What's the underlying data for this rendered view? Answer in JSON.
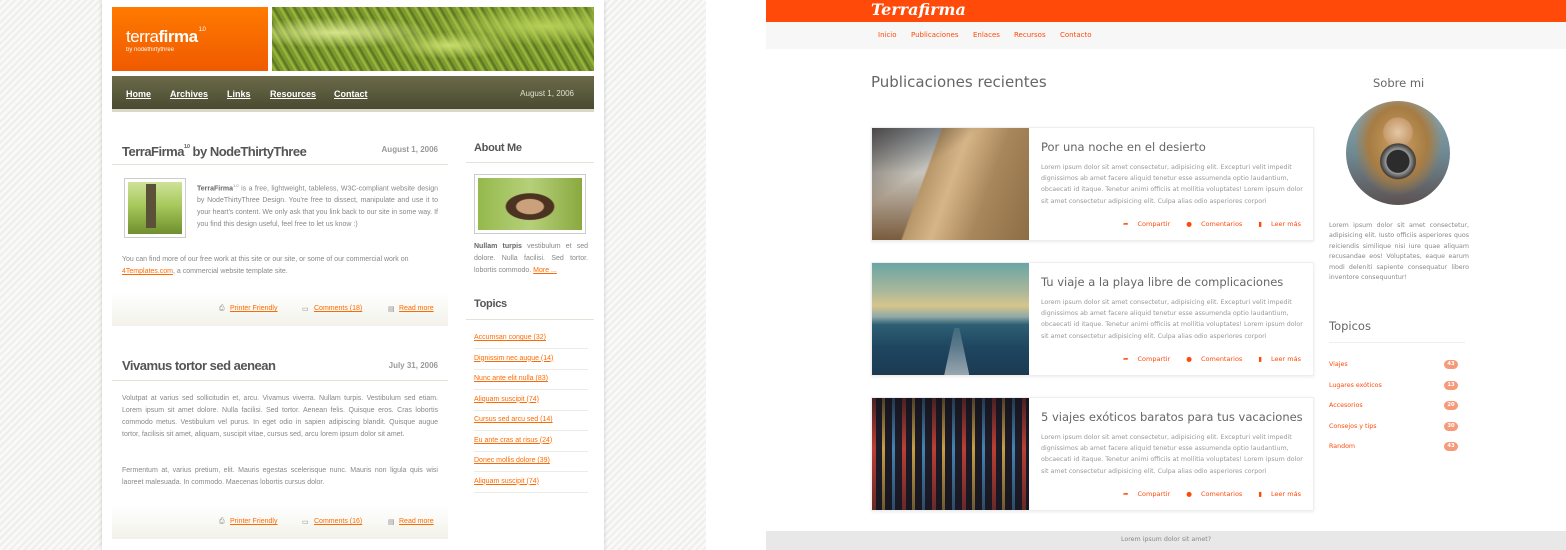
{
  "left": {
    "logo_light": "terra",
    "logo_bold": "firma",
    "logo_version": "1.0",
    "logo_sub": "by nodethirtythree",
    "nav": [
      "Home",
      "Archives",
      "Links",
      "Resources",
      "Contact"
    ],
    "nav_date": "August 1, 2006",
    "post1": {
      "title_main": "TerraFirma",
      "title_sup": "1.0",
      "title_rest": " by NodeThirtyThree",
      "date": "August 1, 2006",
      "p1_bold": "TerraFirma",
      "p1_sup": "1.0",
      "p1_rest": " is a free, lightweight, tableless, W3C-compliant website design by NodeThirtyThree Design. You're free to dissect, manipulate and use it to your heart's content. We only ask that you link back to our site in some way. If you find this design useful, feel free to let us know :)",
      "p2_start": "You can find more of our free work at this site or our site, or some of our commercial work on ",
      "p2_link": "4Templates.com",
      "p2_end": ", a commercial website template site.",
      "printer": "Printer Friendly",
      "comments": "Comments (18)",
      "readmore": "Read more"
    },
    "post2": {
      "title": "Vivamus tortor sed aenean",
      "date": "July 31, 2006",
      "p1": "Volutpat at varius sed sollicitudin et, arcu. Vivamus viverra. Nullam turpis. Vestibulum sed etiam. Lorem ipsum sit amet dolore. Nulla facilisi. Sed tortor. Aenean felis. Quisque eros. Cras lobortis commodo metus. Vestibulum vel purus. In eget odio in sapien adipiscing blandit. Quisque augue tortor, facilisis sit amet, aliquam, suscipit vitae, cursus sed, arcu lorem ipsum dolor sit amet.",
      "p2": "Fermentum at, varius pretium, elit. Mauris egestas scelerisque nunc. Mauris non ligula quis wisi laoreet malesuada. In commodo. Maecenas lobortis cursus dolor.",
      "printer": "Printer Friendly",
      "comments": "Comments (16)",
      "readmore": "Read more"
    },
    "about": {
      "title": "About Me",
      "bold": "Nullam turpis",
      "text": " vestibulum et sed dolore. Nulla facilisi. Sed tortor. lobortis commodo. ",
      "more": "More ..."
    },
    "topics_title": "Topics",
    "topics": [
      "Accumsan congue (32)",
      "Dignissim nec augue (14)",
      "Nunc ante elit nulla (83)",
      "Aliquam suscipit (74)",
      "Cursus sed arcu sed (14)",
      "Eu ante cras at risus (24)",
      "Donec mollis dolore (39)",
      "Aliquam suscipit (74)"
    ]
  },
  "right": {
    "brand": "Terrafirma",
    "nav": [
      "Inicio",
      "Publicaciones",
      "Enlaces",
      "Recursos",
      "Contacto"
    ],
    "heading": "Publicaciones recientes",
    "card_text": "Lorem ipsum dolor sit amet consectetur, adipisicing elit. Excepturi velit impedit dignissimos ab amet facere aliquid tenetur esse assumenda optio laudantium, obcaecati id itaque. Tenetur animi officiis at mollitia voluptates! Lorem ipsum dolor sit amet consectetur adipisicing elit. Culpa alias odio asperiores corpori",
    "actions": {
      "share": "Compartir",
      "comments": "Comentarios",
      "read": "Leer más"
    },
    "cards": [
      {
        "title": "Por una noche en el desierto"
      },
      {
        "title": "Tu viaje a la playa libre de complicaciones"
      },
      {
        "title": "5 viajes exóticos baratos para tus vacaciones"
      }
    ],
    "about_title": "Sobre mi",
    "about_text": "Lorem ipsum dolor sit amet consectetur, adipisicing elit. Iusto officiis asperiores quos reiciendis similique nisi iure quae aliquam recusandae eos! Voluptates, eaque earum modi deleniti sapiente consequatur libero inventore consequuntur!",
    "topics_title": "Topicos",
    "topics": [
      {
        "label": "Viajes",
        "count": "43"
      },
      {
        "label": "Lugares exóticos",
        "count": "13"
      },
      {
        "label": "Accesorios",
        "count": "20"
      },
      {
        "label": "Consejos y tips",
        "count": "30"
      },
      {
        "label": "Random",
        "count": "43"
      }
    ],
    "footer": "Lorem ipsum dolor sit amet?",
    "colors": {
      "accent": "#ff4a0a",
      "badge": "#f59a7b"
    }
  }
}
